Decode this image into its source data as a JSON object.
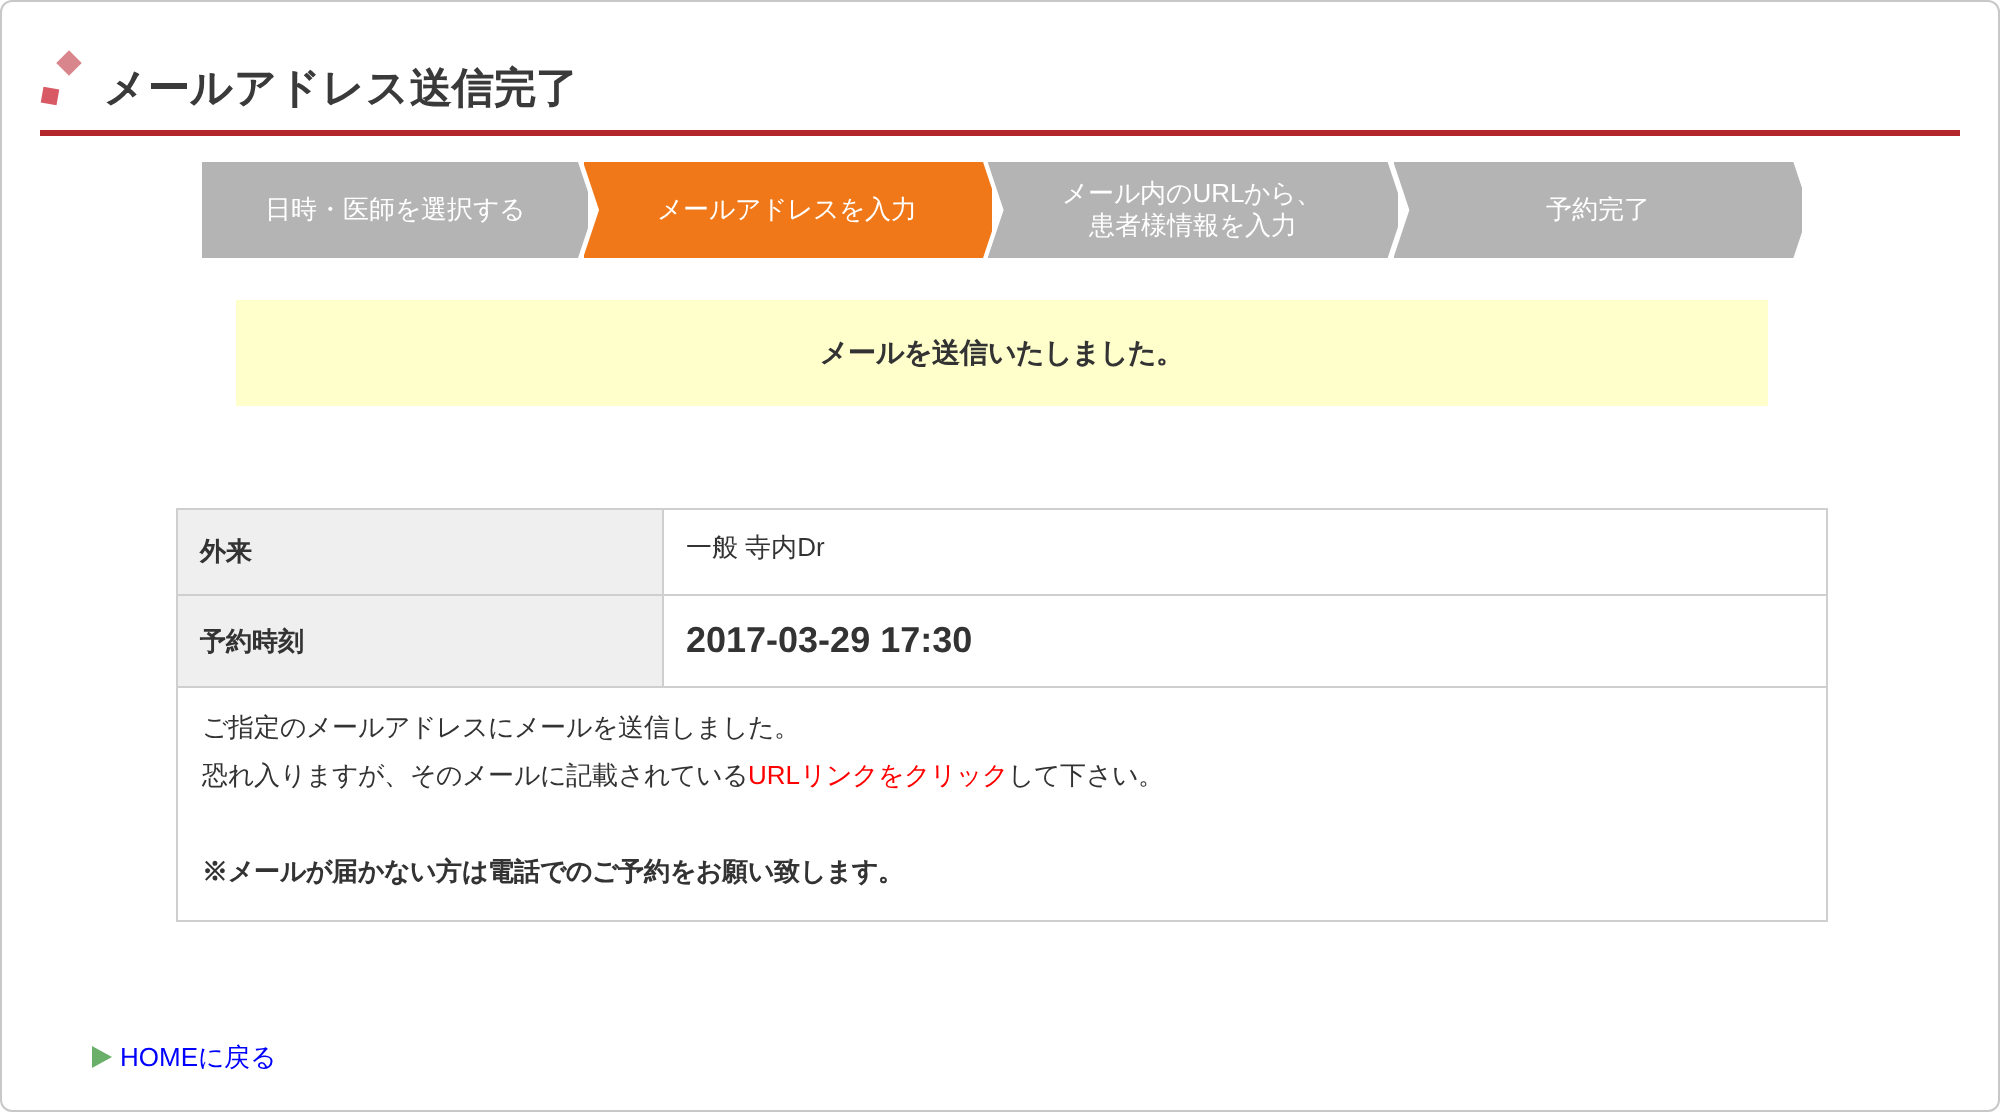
{
  "page_title": "メールアドレス送信完了",
  "steps": [
    {
      "label": "日時・医師を選択する",
      "selected": false
    },
    {
      "label": "メールアドレスを入力",
      "selected": true
    },
    {
      "label": "メール内のURLから、",
      "label_2": "患者様情報を入力",
      "selected": false
    },
    {
      "label": "予約完了",
      "selected": false
    }
  ],
  "notice": "メールを送信いたしました。",
  "details": [
    {
      "label": "外来",
      "value": "一般 寺内Dr",
      "kind": "plain"
    },
    {
      "label": "予約時刻",
      "value": "2017-03-29 17:30",
      "kind": "emphasis"
    }
  ],
  "message": {
    "line_1": "ご指定のメールアドレスにメールを送信しました。",
    "line_2": [
      {
        "text": "恐れ入りますが、そのメールに記載されている",
        "highlight": false
      },
      {
        "text": "URLリンクをクリック",
        "highlight": true
      },
      {
        "text": "して下さい。",
        "highlight": false
      }
    ],
    "warning": "※メールが届かない方は電話でのご予約をお願い致します。"
  },
  "home_link": "HOMEに戻る"
}
